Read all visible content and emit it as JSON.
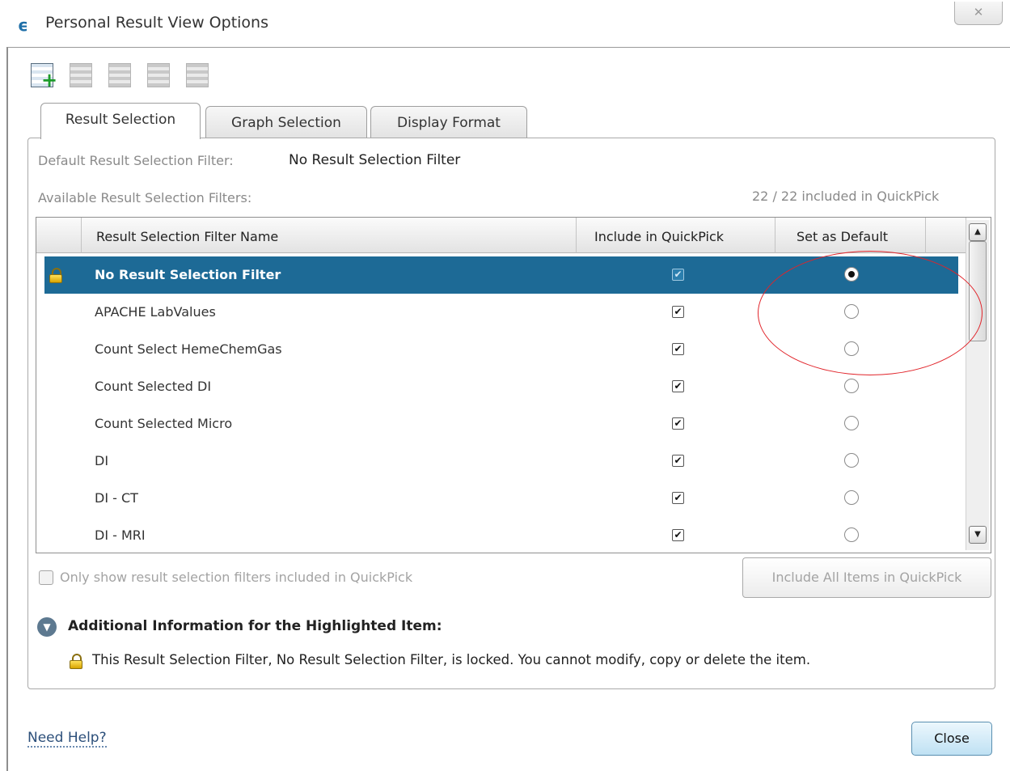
{
  "window": {
    "title": "Personal Result View Options",
    "close_glyph": "✕"
  },
  "toolbar": {
    "icons": [
      "new-filter-icon",
      "edit-filter-icon",
      "copy-filter-icon",
      "delete-filter-icon",
      "properties-filter-icon"
    ]
  },
  "tabs": [
    {
      "label": "Result Selection",
      "selected": true
    },
    {
      "label": "Graph Selection",
      "selected": false
    },
    {
      "label": "Display Format",
      "selected": false
    }
  ],
  "default_filter": {
    "label": "Default Result Selection Filter:",
    "value": "No Result Selection Filter"
  },
  "available": {
    "label": "Available Result Selection Filters:",
    "count": "22 / 22 included in QuickPick"
  },
  "table": {
    "columns": [
      "Result Selection Filter Name",
      "Include in QuickPick",
      "Set as Default"
    ],
    "rows": [
      {
        "name": "No Result Selection Filter",
        "included": true,
        "default": true,
        "locked": true,
        "selected": true
      },
      {
        "name": "APACHE LabValues",
        "included": true,
        "default": false
      },
      {
        "name": "Count Select HemeChemGas",
        "included": true,
        "default": false
      },
      {
        "name": "Count Selected DI",
        "included": true,
        "default": false
      },
      {
        "name": "Count Selected Micro",
        "included": true,
        "default": false
      },
      {
        "name": "DI",
        "included": true,
        "default": false
      },
      {
        "name": "DI - CT",
        "included": true,
        "default": false
      },
      {
        "name": "DI - MRI",
        "included": true,
        "default": false
      }
    ]
  },
  "bottom": {
    "only_show_label": "Only show result selection filters included in QuickPick",
    "include_all_button": "Include All Items in QuickPick",
    "info_header": "Additional Information for the Highlighted Item:",
    "info_text": "This Result Selection Filter, No Result Selection Filter, is locked. You cannot modify, copy or delete the item."
  },
  "footer": {
    "help_link": "Need Help?",
    "close_button": "Close"
  },
  "colors": {
    "selection": "#1d6a96",
    "annotation": "#e1242a"
  }
}
